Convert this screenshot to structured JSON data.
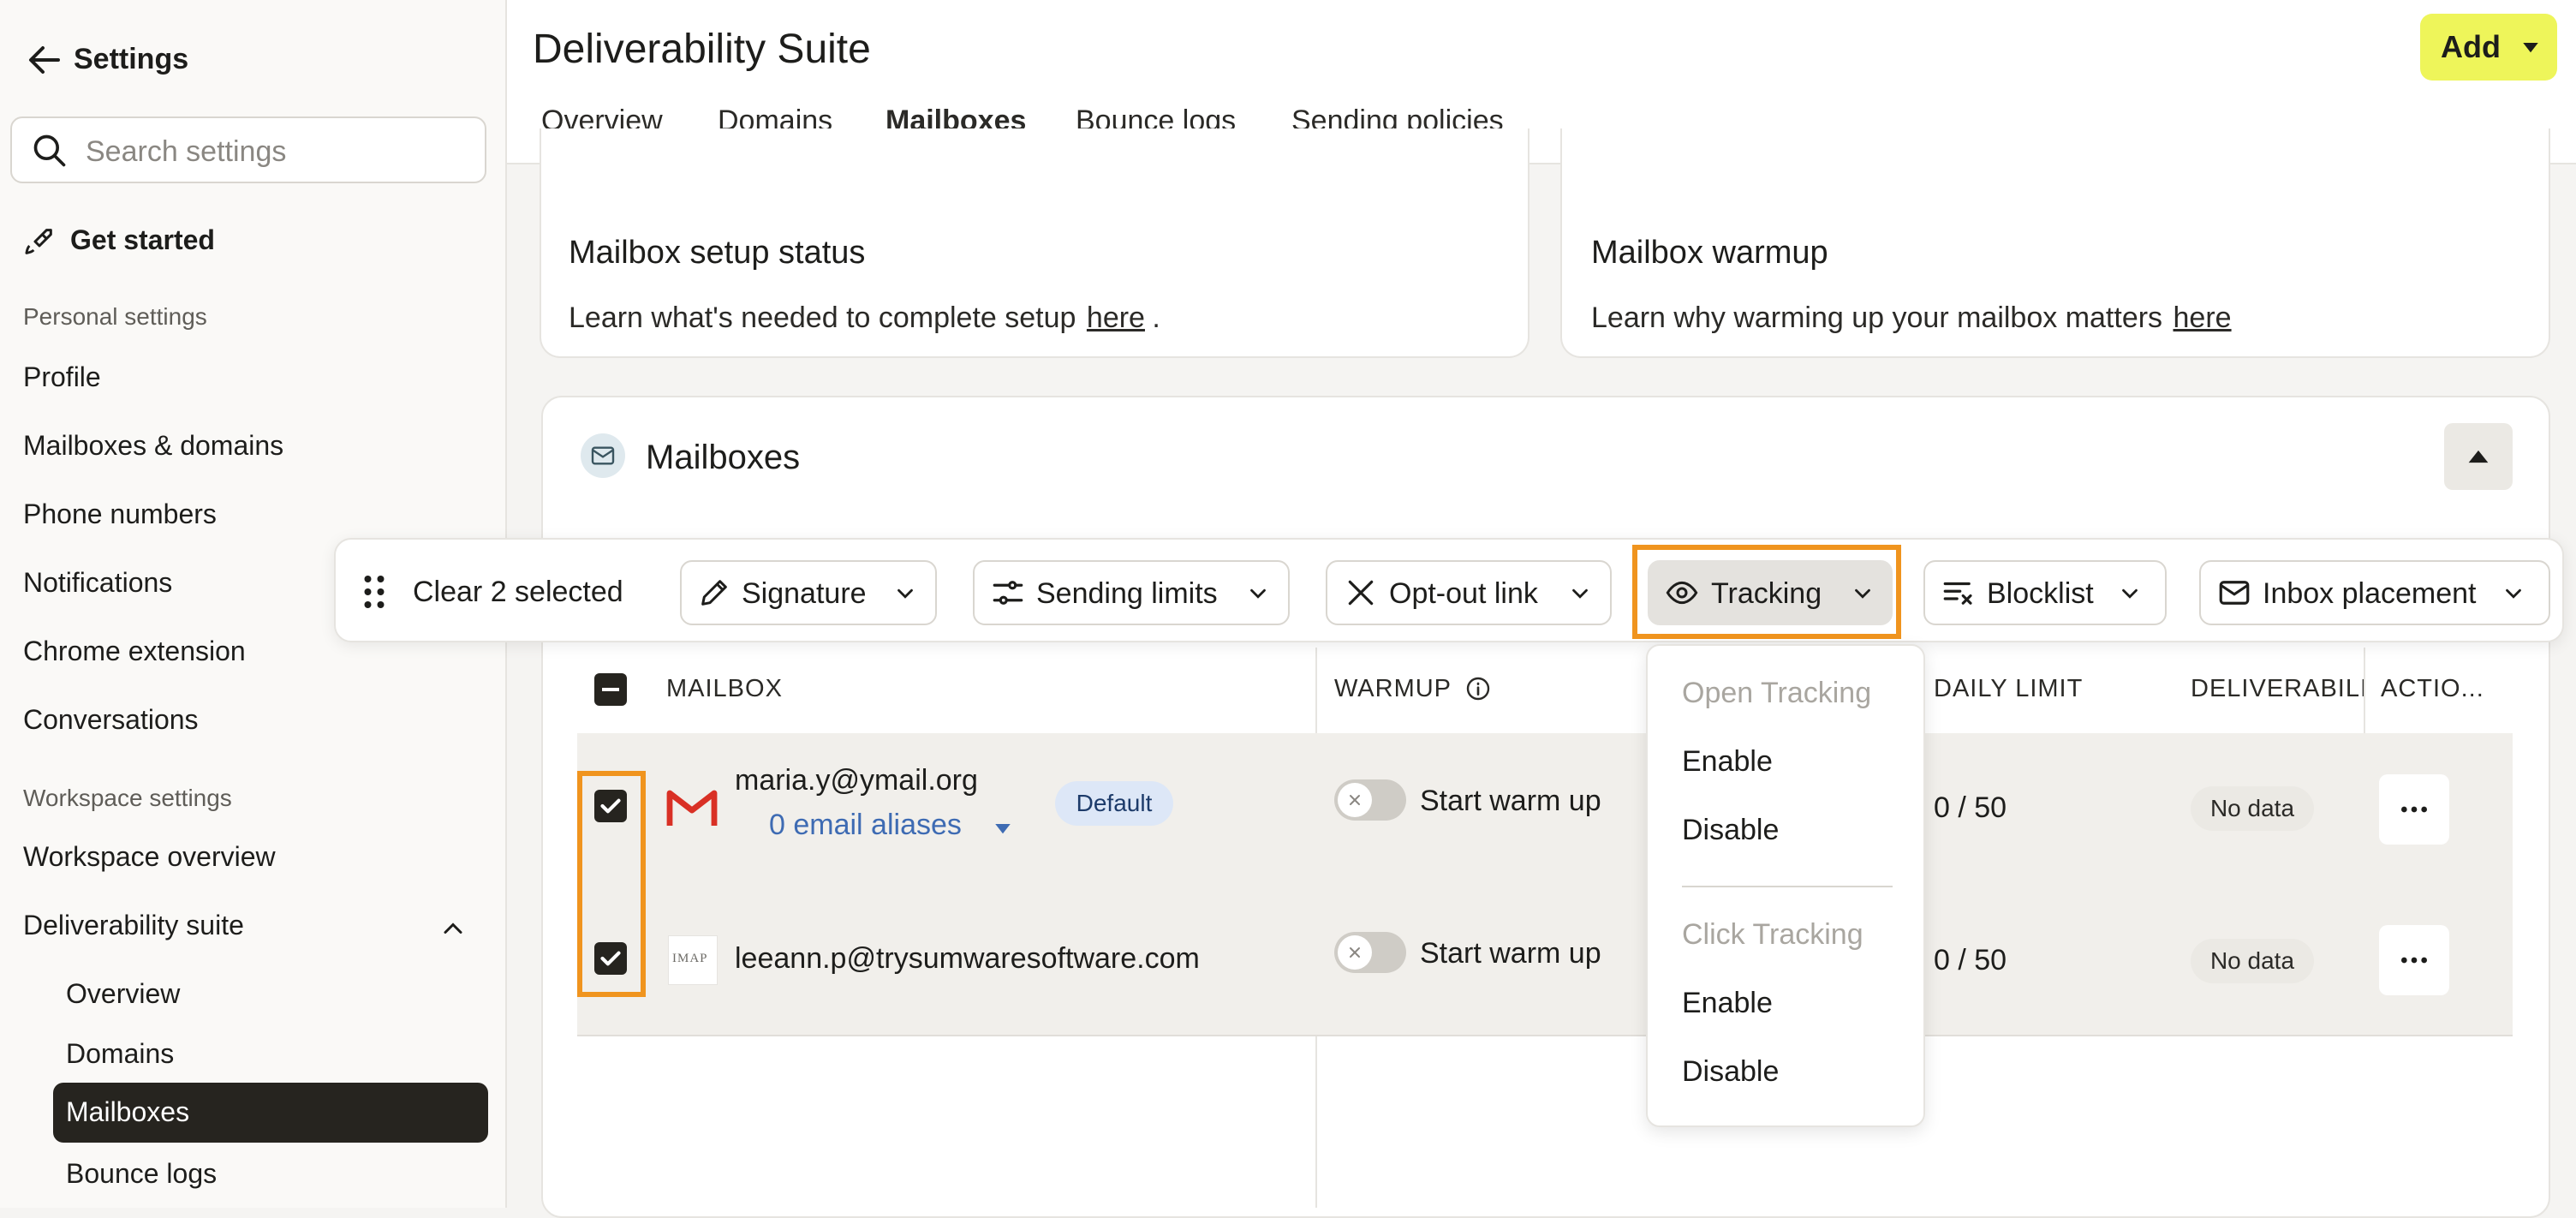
{
  "sidebar": {
    "back_label": "Settings",
    "search_placeholder": "Search settings",
    "get_started": "Get started",
    "personal_heading": "Personal settings",
    "personal_items": [
      "Profile",
      "Mailboxes & domains",
      "Phone numbers",
      "Notifications",
      "Chrome extension",
      "Conversations"
    ],
    "workspace_heading": "Workspace settings",
    "workspace_overview": "Workspace overview",
    "deliverability_label": "Deliverability suite",
    "deliverability_children": [
      "Overview",
      "Domains",
      "Mailboxes",
      "Bounce logs"
    ],
    "active_child": "Mailboxes"
  },
  "header": {
    "title": "Deliverability Suite",
    "add_label": "Add",
    "tabs": [
      "Overview",
      "Domains",
      "Mailboxes",
      "Bounce logs",
      "Sending policies"
    ],
    "active_tab": "Mailboxes"
  },
  "cards": {
    "setup": {
      "title": "Mailbox setup status",
      "text": "Learn what's needed to complete setup",
      "link": "here",
      "trail": "."
    },
    "warmup": {
      "title": "Mailbox warmup",
      "text": "Learn why warming up your mailbox matters",
      "link": "here"
    }
  },
  "mailboxes_section": {
    "title": "Mailboxes"
  },
  "toolbar": {
    "clear_label": "Clear 2 selected",
    "signature": "Signature",
    "sending_limits": "Sending limits",
    "opt_out": "Opt-out link",
    "tracking": "Tracking",
    "blocklist": "Blocklist",
    "inbox_placement": "Inbox placement"
  },
  "table": {
    "headers": {
      "mailbox": "MAILBOX",
      "warmup": "WARMUP",
      "daily_limit": "DAILY LIMIT",
      "deliverability": "DELIVERABILI",
      "actions": "ACTIO..."
    },
    "rows": [
      {
        "email": "maria.y@ymail.org",
        "aliases": "0 email aliases",
        "badge": "Default",
        "warmup": "Start warm up",
        "limit": "0 / 50",
        "deliverability": "No data",
        "provider_icon": "gmail-icon"
      },
      {
        "email": "leeann.p@trysumwaresoftware.com",
        "warmup": "Start warm up",
        "limit": "0 / 50",
        "deliverability": "No data",
        "provider_icon": "imap-icon",
        "provider_text": "IMAP"
      }
    ]
  },
  "tracking_menu": {
    "open_heading": "Open Tracking",
    "open_enable": "Enable",
    "open_disable": "Disable",
    "click_heading": "Click Tracking",
    "click_enable": "Enable",
    "click_disable": "Disable"
  },
  "colors": {
    "accent_yellow": "#eef55a",
    "highlight_orange": "#f0941e",
    "dark": "#26241f",
    "link_blue": "#3e6bb3",
    "gmail_red": "#d93025"
  }
}
